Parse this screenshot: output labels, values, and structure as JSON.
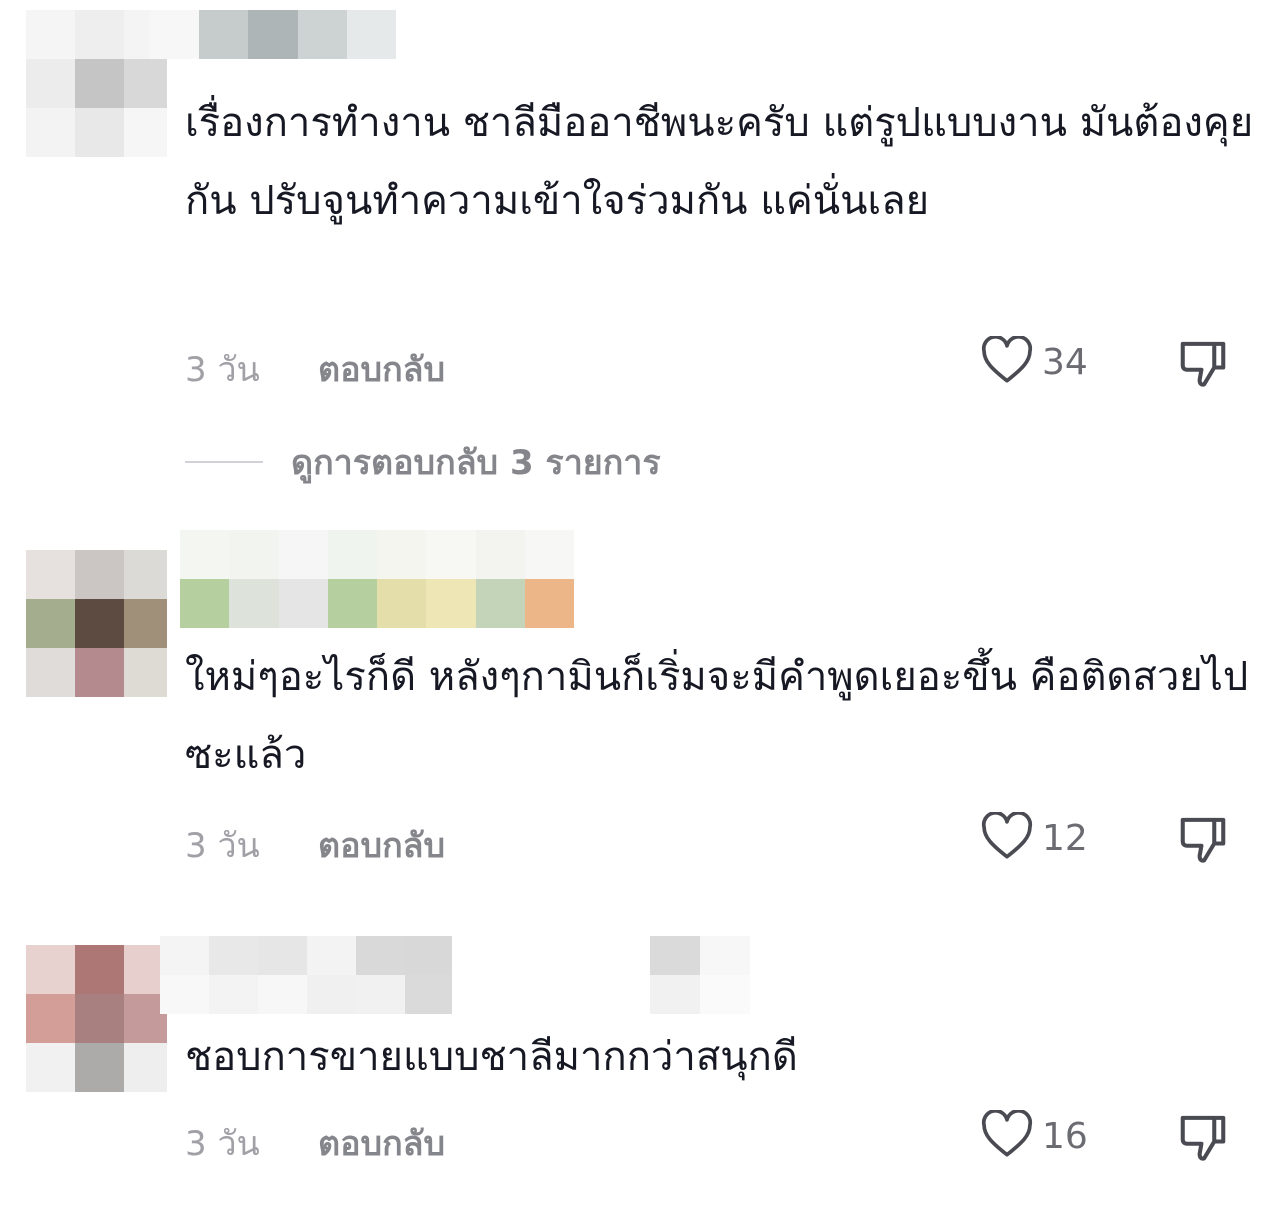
{
  "comments": [
    {
      "text": "เรื่องการทำงาน ชาลีมืออาชีพนะครับ แต่รูปแบบงาน มันต้องคุยกัน ปรับจูนทำความเข้าใจร่วมกัน แค่นั่นเลย",
      "timestamp": "3 วัน",
      "reply_label": "ตอบกลับ",
      "like_count": "34",
      "like_icon": "heart-outline-icon",
      "dislike_icon": "thumbs-down-icon"
    },
    {
      "text": "ใหม่ๆอะไรก็ดี หลังๆกามินก็เริ่มจะมีคำพูดเยอะขึ้น คือติดสวยไปซะแล้ว",
      "timestamp": "3 วัน",
      "reply_label": "ตอบกลับ",
      "like_count": "12",
      "like_icon": "heart-outline-icon",
      "dislike_icon": "thumbs-down-icon"
    },
    {
      "text": "ชอบการขายแบบชาลีมากกว่าสนุกดี",
      "timestamp": "3 วัน",
      "reply_label": "ตอบกลับ",
      "like_count": "16",
      "like_icon": "heart-outline-icon",
      "dislike_icon": "thumbs-down-icon"
    }
  ],
  "view_replies": {
    "label": "ดูการตอบกลับ 3 รายการ"
  },
  "colors": {
    "text_primary": "#161823",
    "text_secondary": "#a0a0a6",
    "reply_link": "#85858c",
    "icon": "#4a4a52",
    "divider": "#d2d2d6"
  }
}
